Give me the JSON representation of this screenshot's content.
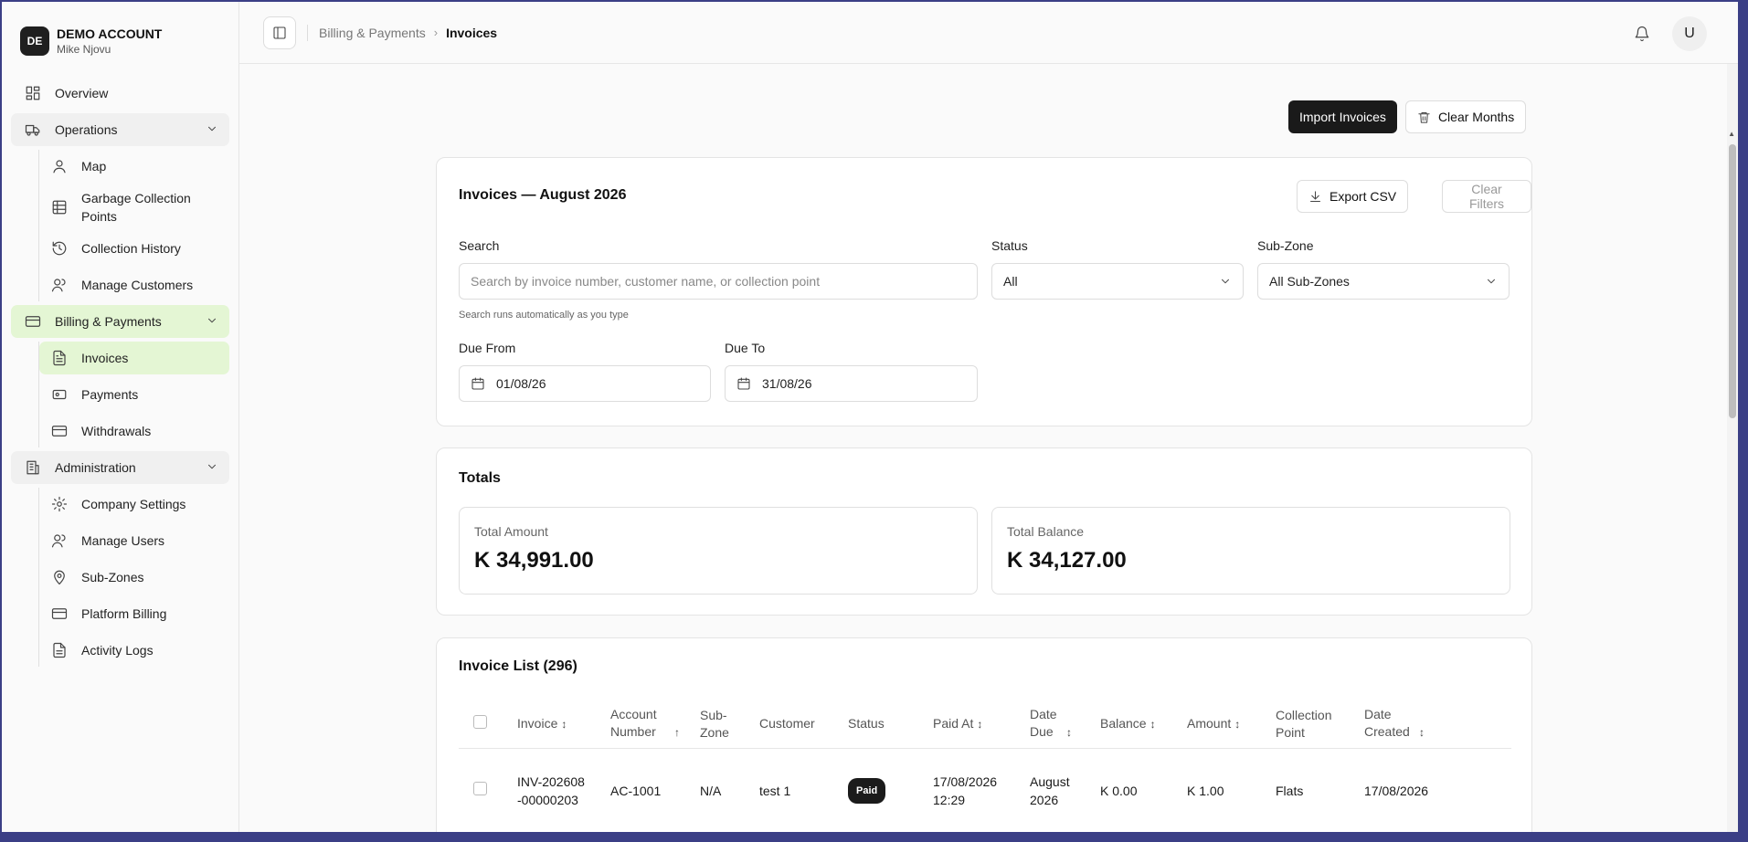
{
  "account": {
    "badge": "DE",
    "name": "DEMO ACCOUNT",
    "user": "Mike Njovu"
  },
  "nav": {
    "overview": "Overview",
    "operations": {
      "label": "Operations",
      "items": [
        "Map",
        "Garbage Collection Points",
        "Collection History",
        "Manage Customers"
      ]
    },
    "billing": {
      "label": "Billing & Payments",
      "items": [
        "Invoices",
        "Payments",
        "Withdrawals"
      ]
    },
    "administration": {
      "label": "Administration",
      "items": [
        "Company Settings",
        "Manage Users",
        "Sub-Zones",
        "Platform Billing",
        "Activity Logs"
      ]
    }
  },
  "breadcrumb": {
    "parent": "Billing & Payments",
    "current": "Invoices"
  },
  "user_avatar": "U",
  "actions": {
    "import": "Import Invoices",
    "clear_months": "Clear Months"
  },
  "filters": {
    "title": "Invoices — August 2026",
    "export": "Export CSV",
    "clear_filters": "Clear Filters",
    "search_label": "Search",
    "search_placeholder": "Search by invoice number, customer name, or collection point",
    "search_hint": "Search runs automatically as you type",
    "status_label": "Status",
    "status_value": "All",
    "subzone_label": "Sub-Zone",
    "subzone_value": "All Sub-Zones",
    "due_from_label": "Due From",
    "due_from_value": "01/08/26",
    "due_to_label": "Due To",
    "due_to_value": "31/08/26"
  },
  "totals": {
    "title": "Totals",
    "amount_label": "Total Amount",
    "amount_value": "K 34,991.00",
    "balance_label": "Total Balance",
    "balance_value": "K 34,127.00"
  },
  "invoice_list": {
    "title": "Invoice List (296)",
    "columns": {
      "invoice": "Invoice",
      "account_number": "Account Number",
      "sub_zone": "Sub-Zone",
      "customer": "Customer",
      "status": "Status",
      "paid_at": "Paid At",
      "date_due": "Date Due",
      "balance": "Balance",
      "amount": "Amount",
      "collection_point": "Collection Point",
      "date_created": "Date Created"
    },
    "rows": [
      {
        "invoice": "INV-202608-00000203",
        "account_number": "AC-1001",
        "sub_zone": "N/A",
        "customer": "test 1",
        "status": "Paid",
        "paid_at": "17/08/2026 12:29",
        "date_due": "August 2026",
        "balance": "K 0.00",
        "amount": "K 1.00",
        "collection_point": "Flats",
        "date_created": "17/08/2026"
      }
    ]
  },
  "colors": {
    "accent_active": "#e4f6d4",
    "primary_dark": "#1a1a1a"
  }
}
